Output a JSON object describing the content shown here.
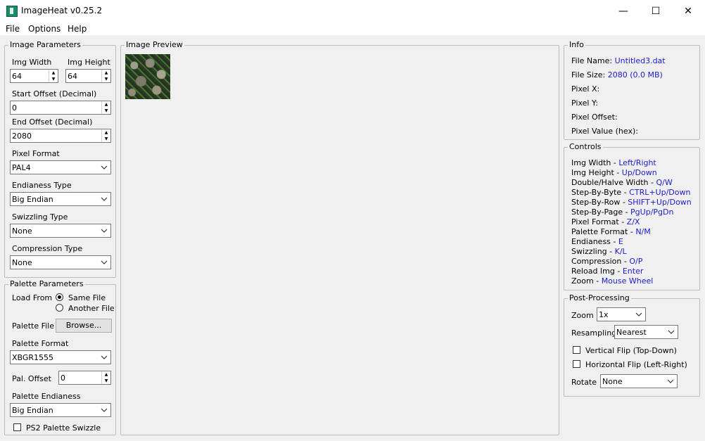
{
  "app": {
    "title": "ImageHeat v0.25.2"
  },
  "window_controls": {
    "minimize": "—",
    "maximize": "☐",
    "close": "✕"
  },
  "menu": [
    "File",
    "Options",
    "Help"
  ],
  "image_params": {
    "legend": "Image Parameters",
    "width_label": "Img Width",
    "width_value": "64",
    "height_label": "Img Height",
    "height_value": "64",
    "start_offset_label": "Start Offset (Decimal)",
    "start_offset_value": "0",
    "end_offset_label": "End Offset (Decimal)",
    "end_offset_value": "2080",
    "pixel_format_label": "Pixel Format",
    "pixel_format_value": "PAL4",
    "endianess_label": "Endianess Type",
    "endianess_value": "Big Endian",
    "swizzling_label": "Swizzling Type",
    "swizzling_value": "None",
    "compression_label": "Compression Type",
    "compression_value": "None"
  },
  "palette_params": {
    "legend": "Palette Parameters",
    "load_from_label": "Load From",
    "same_file": "Same File",
    "another_file": "Another File",
    "load_from_selected": "same_file",
    "palette_file_label": "Palette File",
    "browse_button": "Browse...",
    "palette_format_label": "Palette Format",
    "palette_format_value": "XBGR1555",
    "pal_offset_label": "Pal. Offset",
    "pal_offset_value": "0",
    "palette_endianess_label": "Palette Endianess",
    "palette_endianess_value": "Big Endian",
    "ps2_swizzle_label": "PS2 Palette Swizzle",
    "ps2_swizzle_checked": false
  },
  "preview": {
    "legend": "Image Preview"
  },
  "info": {
    "legend": "Info",
    "file_name_label": "File Name:",
    "file_name_value": "Untitled3.dat",
    "file_size_label": "File Size:",
    "file_size_value": "2080 (0.0 MB)",
    "pixel_x_label": "Pixel X:",
    "pixel_y_label": "Pixel Y:",
    "pixel_offset_label": "Pixel Offset:",
    "pixel_value_label": "Pixel Value (hex):"
  },
  "controls": {
    "legend": "Controls",
    "items": [
      {
        "label": "Img Width - ",
        "key": "Left/Right"
      },
      {
        "label": "Img Height - ",
        "key": "Up/Down"
      },
      {
        "label": "Double/Halve Width - ",
        "key": "Q/W"
      },
      {
        "label": "Step-By-Byte - ",
        "key": "CTRL+Up/Down"
      },
      {
        "label": "Step-By-Row - ",
        "key": "SHIFT+Up/Down"
      },
      {
        "label": "Step-By-Page - ",
        "key": "PgUp/PgDn"
      },
      {
        "label": "Pixel Format - ",
        "key": "Z/X"
      },
      {
        "label": "Palette Format - ",
        "key": "N/M"
      },
      {
        "label": "Endianess - ",
        "key": "E"
      },
      {
        "label": "Swizzling - ",
        "key": "K/L"
      },
      {
        "label": "Compression - ",
        "key": "O/P"
      },
      {
        "label": "Reload Img - ",
        "key": "Enter"
      },
      {
        "label": "Zoom - ",
        "key": "Mouse Wheel"
      }
    ]
  },
  "post_processing": {
    "legend": "Post-Processing",
    "zoom_label": "Zoom",
    "zoom_value": "1x",
    "resampling_label": "Resampling",
    "resampling_value": "Nearest",
    "vflip_label": "Vertical Flip (Top-Down)",
    "vflip_checked": false,
    "hflip_label": "Horizontal Flip (Left-Right)",
    "hflip_checked": false,
    "rotate_label": "Rotate",
    "rotate_value": "None"
  }
}
